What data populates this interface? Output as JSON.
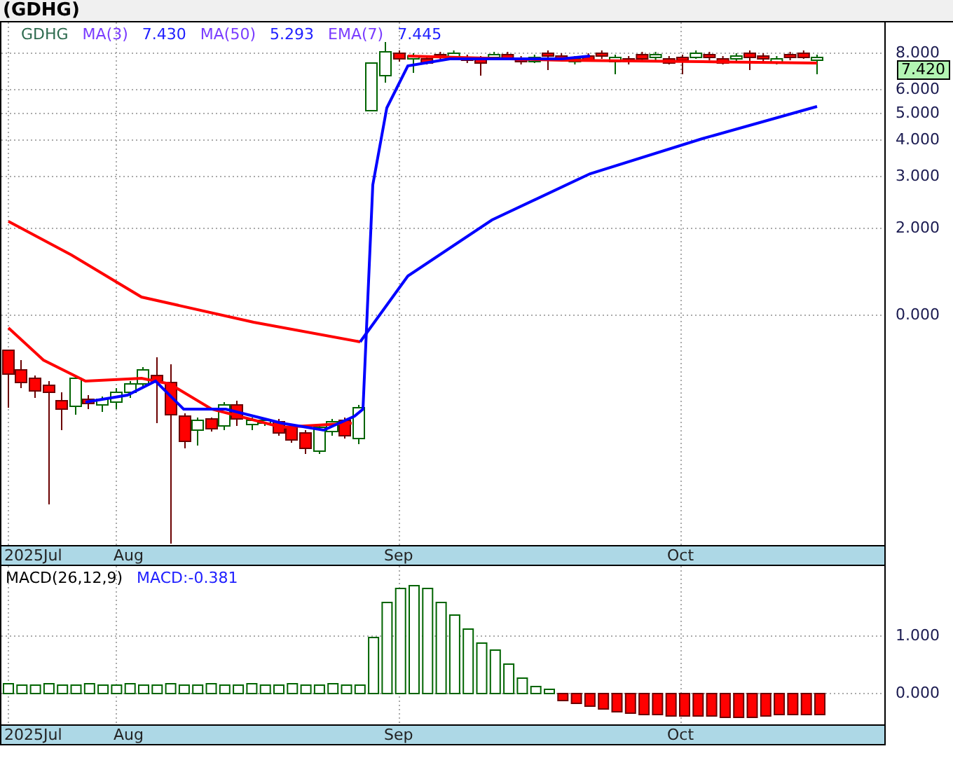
{
  "header": {
    "title": "(GDHG)"
  },
  "price_panel": {
    "legend": [
      {
        "text": "GDHG",
        "color": "#2e6b4f"
      },
      {
        "text": "MA(3)",
        "color": "#7a3cff"
      },
      {
        "text": "7.430",
        "color": "#2020ff"
      },
      {
        "text": "MA(50)",
        "color": "#7a3cff"
      },
      {
        "text": "5.293",
        "color": "#2020ff"
      },
      {
        "text": "EMA(7)",
        "color": "#7a3cff"
      },
      {
        "text": "7.445",
        "color": "#2020ff"
      }
    ],
    "y_ticks": [
      "8.000",
      "6.000",
      "5.000",
      "4.000",
      "3.000",
      "2.000",
      "0.000"
    ],
    "last_price": "7.420"
  },
  "date_axis_top": [
    "2025Jul",
    "Aug",
    "Sep",
    "Oct"
  ],
  "macd_panel": {
    "legend": [
      {
        "text": "MACD(26,12,9)",
        "color": "#000000"
      },
      {
        "text": "MACD:-0.381",
        "color": "#2020ff"
      }
    ],
    "y_ticks": [
      "1.000",
      "0.000"
    ]
  },
  "date_axis_bottom": [
    "2025Jul",
    "Aug",
    "Sep",
    "Oct"
  ]
}
